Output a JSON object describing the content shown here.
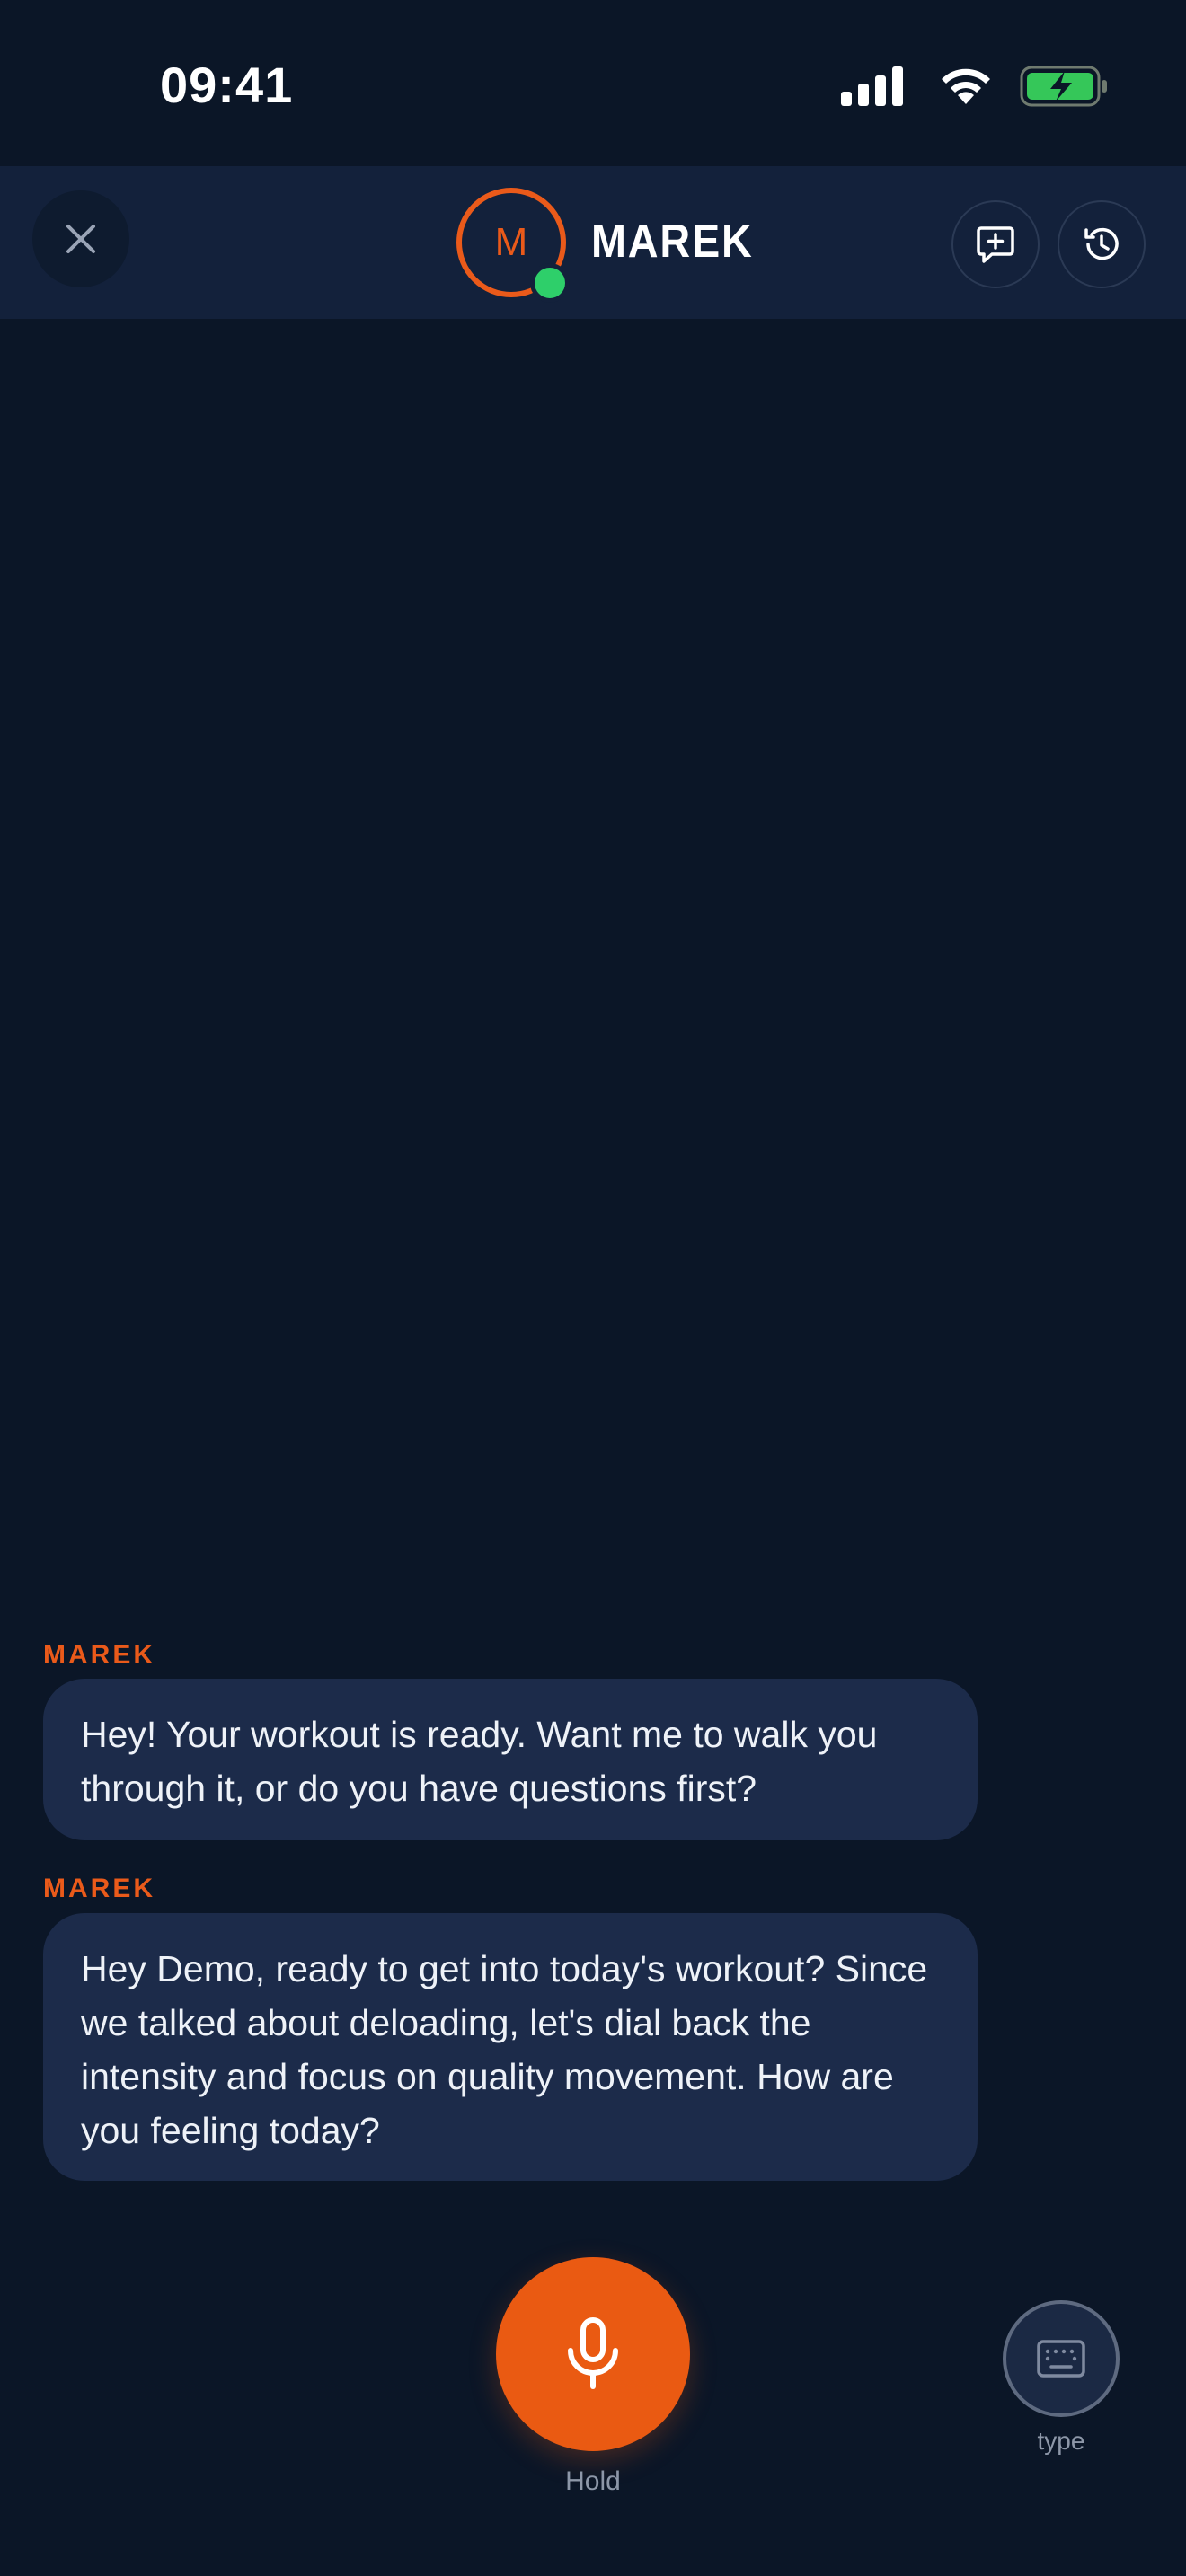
{
  "status_bar": {
    "time": "09:41"
  },
  "header": {
    "coach_initial": "M",
    "coach_name": "MAREK"
  },
  "messages": [
    {
      "sender": "MAREK",
      "text": "Hey! Your workout is ready. Want me to walk you through it, or do you have questions first?"
    },
    {
      "sender": "MAREK",
      "text": "Hey Demo, ready to get into today's workout? Since we talked about deloading, let's dial back the intensity and focus on quality movement. How are you feeling today?"
    }
  ],
  "controls": {
    "hold_label": "Hold",
    "type_label": "type"
  },
  "colors": {
    "accent": "#ea5a12",
    "background": "#0b1627",
    "header": "#13213b",
    "bubble": "#1c2b4a",
    "online": "#2ecf6a"
  },
  "icons": [
    "signal-icon",
    "wifi-icon",
    "battery-charging-icon",
    "close-icon",
    "new-chat-icon",
    "history-icon",
    "microphone-icon",
    "keyboard-icon"
  ]
}
